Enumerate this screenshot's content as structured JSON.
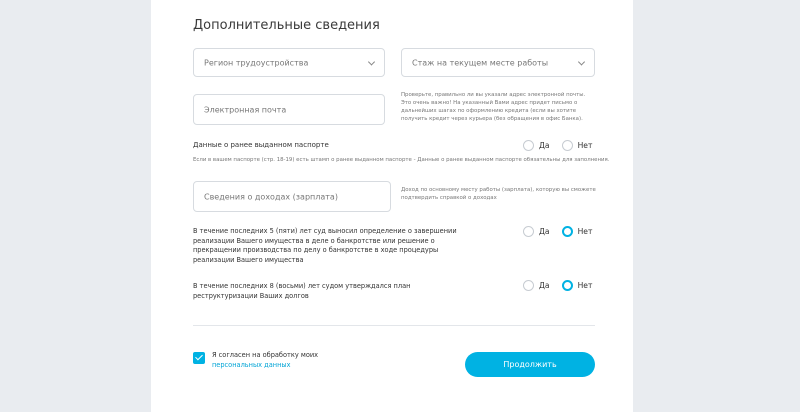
{
  "form": {
    "title": "Дополнительные сведения",
    "region": {
      "placeholder": "Регион трудоустройства"
    },
    "experience": {
      "placeholder": "Стаж на текущем месте работы"
    },
    "email": {
      "placeholder": "Электронная почта",
      "hint": "Проверьте, правильно ли вы указали адрес электронной почты. Это очень важно! На указанный Вами адрес придет письмо о дальнейших шагах по оформлению кредита (если вы хотите получить кредит через курьера (без обращения в офис Банка)."
    },
    "passport": {
      "question": "Данные о ранее выданном паспорте",
      "note": "Если в вашем паспорте (стр. 18-19) есть штамп о ранее выданном паспорте - Данные о ранее выданном паспорте обязательны для заполнения.",
      "yes": "Да",
      "no": "Нет",
      "selected": null
    },
    "income": {
      "placeholder": "Сведения о доходах (зарплата)",
      "hint": "Доход по основному месту работы (зарплата), которую вы сможете подтвердить справкой о доходах"
    },
    "bankruptcy": {
      "question": "В течение последних 5 (пяти) лет суд выносил определение о завершении реализации Вашего имущества в деле о банкротстве или решение о прекращении производства по делу о банкротстве в ходе процедуры реализации Вашего имущества",
      "yes": "Да",
      "no": "Нет",
      "selected": "no"
    },
    "restructuring": {
      "question": "В течение последних 8 (восьми) лет судом утверждался план реструктуризации Ваших долгов",
      "yes": "Да",
      "no": "Нет",
      "selected": "no"
    },
    "consent": {
      "checked": true,
      "text_before": "Я согласен на обработку моих ",
      "link": "персональных данных"
    },
    "submit": "Продолжить"
  },
  "colors": {
    "accent": "#00b2e3",
    "background": "#e9ecf0",
    "card": "#ffffff"
  }
}
